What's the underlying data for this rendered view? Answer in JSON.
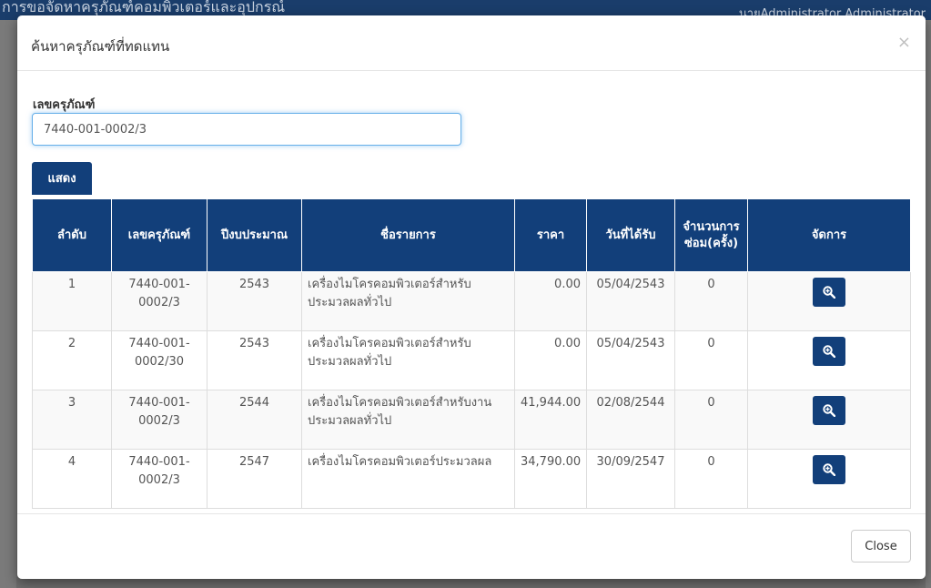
{
  "background": {
    "title": "การขอจัดหาครุภัณฑ์คอมพิวเตอร์และอุปกรณ์",
    "user": "นายAdministrator Administrator"
  },
  "modal": {
    "title": "ค้นหาครุภัณฑ์ที่ทดแทน",
    "field_label": "เลขครุภัณฑ์",
    "field_value": "7440-001-0002/3",
    "show_button": "แสดง",
    "close_button": "Close",
    "close_icon": "×"
  },
  "table": {
    "headers": [
      "ลำดับ",
      "เลขครุภัณฑ์",
      "ปีงบประมาณ",
      "ชื่อรายการ",
      "ราคา",
      "วันที่ได้รับ",
      "จำนวนการซ่อม(ครั้ง)",
      "จัดการ"
    ],
    "rows": [
      {
        "no": "1",
        "asset_no": "7440-001-0002/3",
        "year": "2543",
        "name": "เครื่องไมโครคอมพิวเตอร์สำหรับประมวลผลทั่วไป",
        "price": "0.00",
        "received": "05/04/2543",
        "repairs": "0"
      },
      {
        "no": "2",
        "asset_no": "7440-001-0002/30",
        "year": "2543",
        "name": "เครื่องไมโครคอมพิวเตอร์สำหรับประมวลผลทั่วไป",
        "price": "0.00",
        "received": "05/04/2543",
        "repairs": "0"
      },
      {
        "no": "3",
        "asset_no": "7440-001-0002/3",
        "year": "2544",
        "name": "เครื่องไมโครคอมพิวเตอร์สำหรับงานประมวลผลทั่วไป",
        "price": "41,944.00",
        "received": "02/08/2544",
        "repairs": "0"
      },
      {
        "no": "4",
        "asset_no": "7440-001-0002/3",
        "year": "2547",
        "name": "เครื่องไมโครคอมพิวเตอร์ประมวลผล",
        "price": "34,790.00",
        "received": "30/09/2547",
        "repairs": "0"
      }
    ]
  },
  "colors": {
    "primary": "#123f7a",
    "overlay": "#6e6e6e",
    "focus": "#66afe9"
  },
  "icons": {
    "view": "search-plus-icon",
    "close": "close-icon"
  }
}
